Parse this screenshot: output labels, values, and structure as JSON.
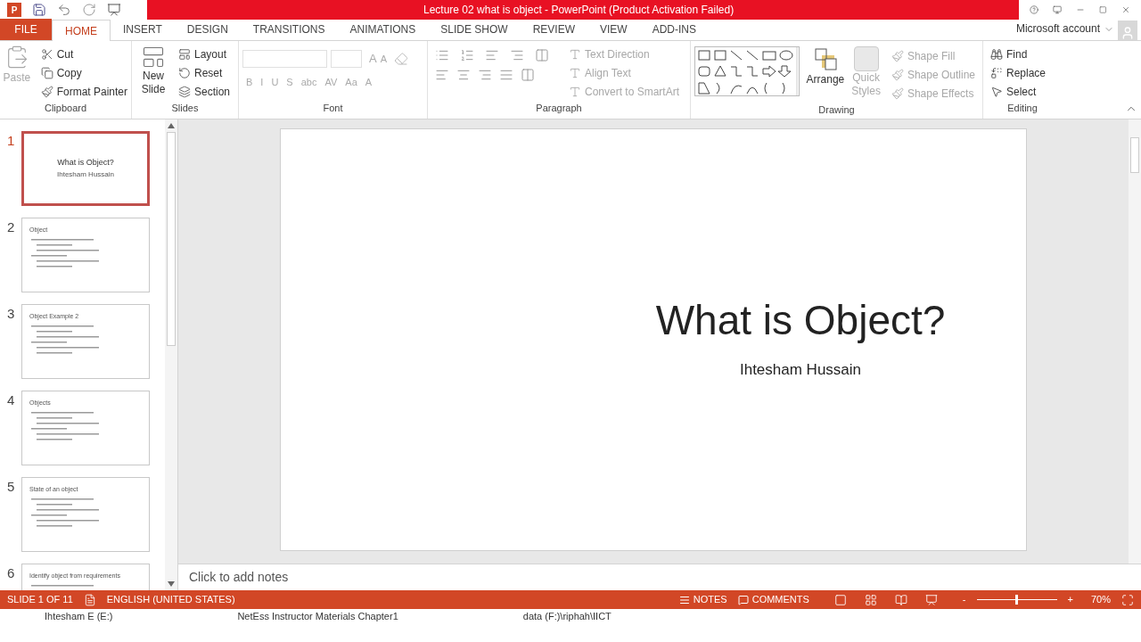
{
  "window": {
    "title": "Lecture 02 what is object -  PowerPoint (Product Activation Failed)",
    "app_badge": "P"
  },
  "tabs": [
    {
      "label": "FILE",
      "kind": "file",
      "selected": false
    },
    {
      "label": "HOME",
      "kind": "tab",
      "selected": true
    },
    {
      "label": "INSERT",
      "kind": "tab",
      "selected": false
    },
    {
      "label": "DESIGN",
      "kind": "tab",
      "selected": false
    },
    {
      "label": "TRANSITIONS",
      "kind": "tab",
      "selected": false
    },
    {
      "label": "ANIMATIONS",
      "kind": "tab",
      "selected": false
    },
    {
      "label": "SLIDE SHOW",
      "kind": "tab",
      "selected": false
    },
    {
      "label": "REVIEW",
      "kind": "tab",
      "selected": false
    },
    {
      "label": "VIEW",
      "kind": "tab",
      "selected": false
    },
    {
      "label": "ADD-INS",
      "kind": "tab",
      "selected": false
    }
  ],
  "account": "Microsoft account",
  "clipboard": {
    "label": "Clipboard",
    "paste": {
      "label": "Paste",
      "disabled": true
    },
    "items": [
      {
        "label": "Cut",
        "disabled": false
      },
      {
        "label": "Copy",
        "disabled": false
      },
      {
        "label": "Format Painter",
        "disabled": false
      }
    ]
  },
  "slides_group": {
    "label": "Slides",
    "new_slide": [
      "New",
      "Slide"
    ],
    "items": [
      {
        "label": "Layout"
      },
      {
        "label": "Reset"
      },
      {
        "label": "Section"
      }
    ]
  },
  "font": {
    "label": "Font",
    "grow": "A",
    "shrink": "A",
    "buttons": [
      "B",
      "I",
      "U",
      "S",
      "abc",
      "AV",
      "Aa",
      "A"
    ],
    "disabled": true
  },
  "paragraph": {
    "label": "Paragraph",
    "items": [
      {
        "label": "Text Direction",
        "disabled": true
      },
      {
        "label": "Align Text",
        "disabled": true
      },
      {
        "label": "Convert to SmartArt",
        "disabled": true
      }
    ]
  },
  "drawing": {
    "label": "Drawing",
    "arrange": "Arrange",
    "quick_styles": [
      "Quick",
      "Styles"
    ],
    "items": [
      {
        "label": "Shape Fill",
        "disabled": true
      },
      {
        "label": "Shape Outline",
        "disabled": true
      },
      {
        "label": "Shape Effects",
        "disabled": true
      }
    ]
  },
  "editing": {
    "label": "Editing",
    "items": [
      {
        "label": "Find"
      },
      {
        "label": "Replace"
      },
      {
        "label": "Select"
      }
    ]
  },
  "thumbnails": [
    {
      "number": "1",
      "title": "What is Object?",
      "subtitle": "Ihtesham Hussain",
      "kind": "title",
      "selected": true
    },
    {
      "number": "2",
      "title": "Object",
      "kind": "content",
      "selected": false
    },
    {
      "number": "3",
      "title": "Object Example 2",
      "kind": "content",
      "selected": false
    },
    {
      "number": "4",
      "title": "Objects",
      "kind": "content",
      "selected": false
    },
    {
      "number": "5",
      "title": "State of an object",
      "kind": "content",
      "selected": false
    },
    {
      "number": "6",
      "title": "Identify object from requirements",
      "kind": "content",
      "selected": false
    }
  ],
  "slide": {
    "title": "What is Object?",
    "subtitle": "Ihtesham Hussain"
  },
  "notes_placeholder": "Click to add notes",
  "status_bar": {
    "slide": "SLIDE 1 OF 11",
    "language": "ENGLISH (UNITED STATES)",
    "notes": "NOTES",
    "comments": "COMMENTS",
    "zoom": "70%",
    "minus": "-",
    "plus": "+",
    "level": 0.5
  },
  "background_window": [
    "Ihtesham E (E:)",
    "NetEss  Instructor Materials  Chapter1",
    "data (F:)\\riphah\\IICT"
  ]
}
